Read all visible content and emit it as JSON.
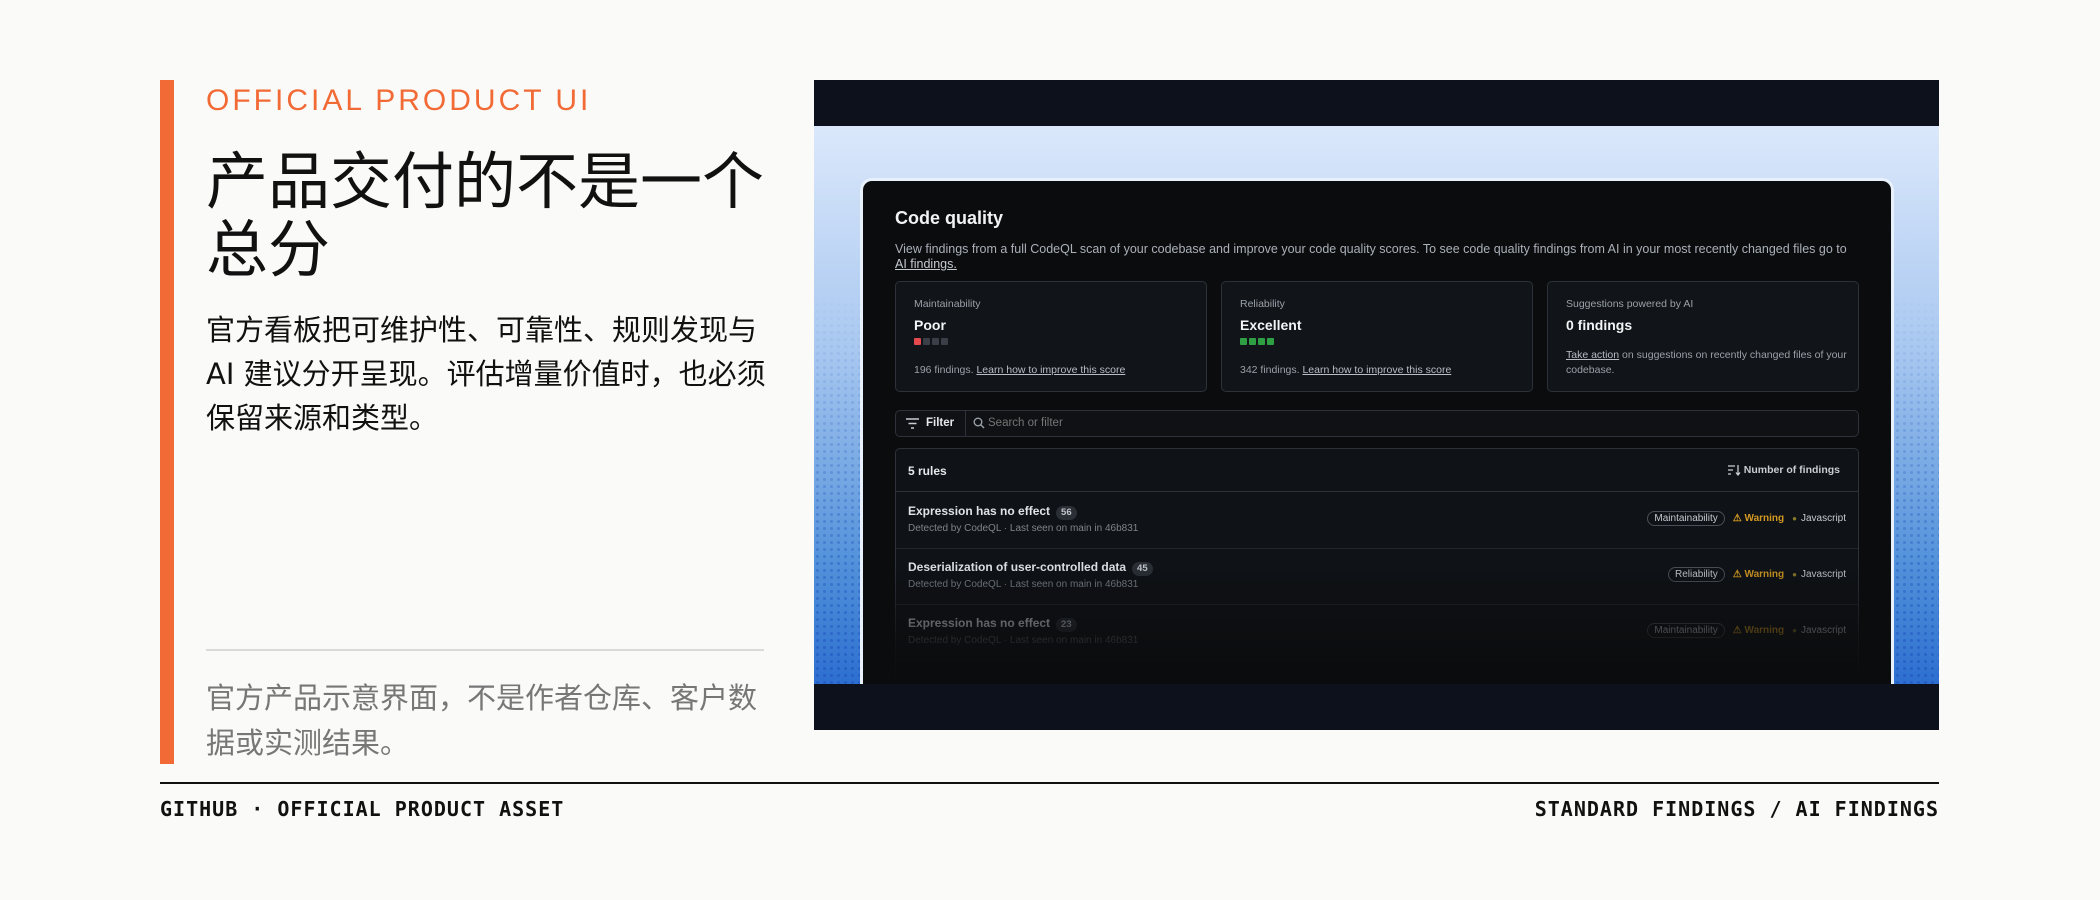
{
  "slide": {
    "eyebrow": "OFFICIAL PRODUCT UI",
    "title": "产品交付的不是一个总分",
    "lede": "官方看板把可维护性、可靠性、规则发现与 AI 建议分开呈现。评估增量价值时，也必须保留来源和类型。",
    "caption": "官方产品示意界面，不是作者仓库、客户数据或实测结果。",
    "footer_left": "GITHUB · OFFICIAL PRODUCT ASSET",
    "footer_right": "STANDARD FINDINGS / AI FINDINGS",
    "accent_color": "#f26a35"
  },
  "code_quality": {
    "title": "Code quality",
    "description": "View findings from a full CodeQL scan of your codebase and improve your code quality scores. To see code quality findings from AI in your  most recently changed files go to",
    "description_link": "AI findings.",
    "cards": [
      {
        "label": "Maintainability",
        "value": "Poor",
        "meter": "1/4",
        "findings": "196 findings.",
        "link": "Learn how to improve this score"
      },
      {
        "label": "Reliability",
        "value": "Excellent",
        "meter": "4/4",
        "findings": "342 findings.",
        "link": "Learn how to improve this score"
      },
      {
        "label": "Suggestions powered by AI",
        "value": "0 findings",
        "link": "Take action",
        "footer_text": "on suggestions on recently changed files of your codebase."
      }
    ],
    "filter_label": "Filter",
    "search_placeholder": "Search or filter",
    "rules_count": "5 rules",
    "sort_label": "Number of findings",
    "rows": [
      {
        "name": "Expression has no effect",
        "count": "56",
        "meta": "Detected by CodeQL · Last seen on main in 46b831",
        "category": "Maintainability",
        "severity": "Warning",
        "language": "Javascript"
      },
      {
        "name": "Deserialization of user-controlled data",
        "count": "45",
        "meta": "Detected by CodeQL · Last seen on main in 46b831",
        "category": "Reliability",
        "severity": "Warning",
        "language": "Javascript"
      },
      {
        "name": "Expression has no effect",
        "count": "23",
        "meta": "Detected by CodeQL · Last seen on main in 46b831",
        "category": "Maintainability",
        "severity": "Warning",
        "language": "Javascript"
      }
    ]
  }
}
